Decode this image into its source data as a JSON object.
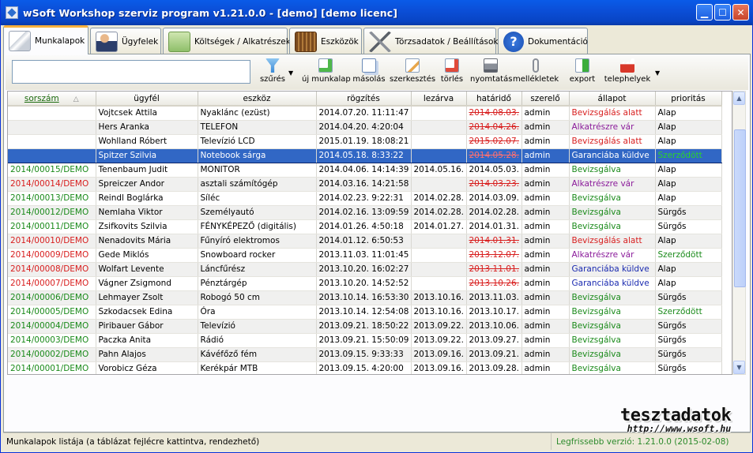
{
  "window": {
    "title": "wSoft Workshop szerviz program v1.21.0.0 - [demo] [demo licenc]"
  },
  "tabs": [
    {
      "label": "Munkalapok",
      "icon": "documents-icon",
      "active": true
    },
    {
      "label": "Ügyfelek",
      "icon": "person-card-icon"
    },
    {
      "label": "Költségek / Alkatrészek",
      "icon": "money-icon"
    },
    {
      "label": "Eszközök",
      "icon": "radio-device-icon"
    },
    {
      "label": "Törzsadatok / Beállítások",
      "icon": "tools-icon"
    },
    {
      "label": "Dokumentáció",
      "icon": "help-icon"
    }
  ],
  "toolbar": {
    "filter_value": "",
    "buttons": [
      {
        "label": "szűrés",
        "icon": "filter-funnel-icon"
      },
      {
        "label": "új munkalap",
        "icon": "new-document-icon"
      },
      {
        "label": "másolás",
        "icon": "copy-icon"
      },
      {
        "label": "szerkesztés",
        "icon": "edit-icon"
      },
      {
        "label": "törlés",
        "icon": "delete-icon"
      },
      {
        "label": "nyomtatás",
        "icon": "printer-icon"
      },
      {
        "label": "mellékletek",
        "icon": "paperclip-icon"
      },
      {
        "label": "export",
        "icon": "export-icon"
      },
      {
        "label": "telephelyek",
        "icon": "factory-icon"
      }
    ]
  },
  "table": {
    "columns": [
      "sorszám",
      "ügyfél",
      "eszköz",
      "rögzítés",
      "lezárva",
      "határidő",
      "szerelő",
      "állapot",
      "prioritás"
    ],
    "rows": [
      {
        "sorszam": "",
        "ugyfel": "Vojtcsek Attila",
        "eszkoz": "Nyaklánc (ezüst)",
        "rogzites": "2014.07.20. 11:11:47",
        "lezarva": "",
        "hatarido": "2014.08.03.",
        "szerelo": "admin",
        "allapot": "Bevizsgálás alatt",
        "prioritas": "Alap"
      },
      {
        "sorszam": "",
        "ugyfel": "Hers Aranka",
        "eszkoz": "TELEFON",
        "rogzites": "2014.04.20. 4:20:04",
        "lezarva": "",
        "hatarido": "2014.04.26.",
        "szerelo": "admin",
        "allapot": "Alkatrészre vár",
        "prioritas": "Alap"
      },
      {
        "sorszam": "",
        "ugyfel": "Wohlland Róbert",
        "eszkoz": "Televízió LCD",
        "rogzites": "2015.01.19. 18:08:21",
        "lezarva": "",
        "hatarido": "2015.02.07.",
        "szerelo": "admin",
        "allapot": "Bevizsgálás alatt",
        "prioritas": "Alap"
      },
      {
        "sorszam": "",
        "ugyfel": "Spitzer Szilvia",
        "eszkoz": "Notebook sárga",
        "rogzites": "2014.05.18. 8:33:22",
        "lezarva": "",
        "hatarido": "2014.05.28.",
        "szerelo": "admin",
        "allapot": "Garanciába küldve",
        "prioritas": "Szerződött"
      },
      {
        "sorszam": "2014/00015/DEMO",
        "ugyfel": "Tenenbaum Judit",
        "eszkoz": "MONITOR",
        "rogzites": "2014.04.06. 14:14:39",
        "lezarva": "2014.05.16.",
        "hatarido": "2014.05.03.",
        "szerelo": "admin",
        "allapot": "Bevizsgálva",
        "prioritas": "Alap"
      },
      {
        "sorszam": "2014/00014/DEMO",
        "ugyfel": "Spreiczer Andor",
        "eszkoz": "asztali számítógép",
        "rogzites": "2014.03.16. 14:21:58",
        "lezarva": "",
        "hatarido": "2014.03.23.",
        "szerelo": "admin",
        "allapot": "Alkatrészre vár",
        "prioritas": "Alap"
      },
      {
        "sorszam": "2014/00013/DEMO",
        "ugyfel": "Reindl Boglárka",
        "eszkoz": "Síléc",
        "rogzites": "2014.02.23. 9:22:31",
        "lezarva": "2014.02.28.",
        "hatarido": "2014.03.09.",
        "szerelo": "admin",
        "allapot": "Bevizsgálva",
        "prioritas": "Alap"
      },
      {
        "sorszam": "2014/00012/DEMO",
        "ugyfel": "Nemlaha Viktor",
        "eszkoz": "Személyautó",
        "rogzites": "2014.02.16. 13:09:59",
        "lezarva": "2014.02.28.",
        "hatarido": "2014.02.28.",
        "szerelo": "admin",
        "allapot": "Bevizsgálva",
        "prioritas": "Sürgős"
      },
      {
        "sorszam": "2014/00011/DEMO",
        "ugyfel": "Zsifkovits Szilvia",
        "eszkoz": "FÉNYKÉPEZŐ (digitális)",
        "rogzites": "2014.01.26. 4:50:18",
        "lezarva": "2014.01.27.",
        "hatarido": "2014.01.31.",
        "szerelo": "admin",
        "allapot": "Bevizsgálva",
        "prioritas": "Sürgős"
      },
      {
        "sorszam": "2014/00010/DEMO",
        "ugyfel": "Nenadovits Mária",
        "eszkoz": "Fűnyíró elektromos",
        "rogzites": "2014.01.12. 6:50:53",
        "lezarva": "",
        "hatarido": "2014.01.31.",
        "szerelo": "admin",
        "allapot": "Bevizsgálás alatt",
        "prioritas": "Alap"
      },
      {
        "sorszam": "2014/00009/DEMO",
        "ugyfel": "Gede Miklós",
        "eszkoz": "Snowboard rocker",
        "rogzites": "2013.11.03. 11:01:45",
        "lezarva": "",
        "hatarido": "2013.12.07.",
        "szerelo": "admin",
        "allapot": "Alkatrészre vár",
        "prioritas": "Szerződött"
      },
      {
        "sorszam": "2014/00008/DEMO",
        "ugyfel": "Wolfart Levente",
        "eszkoz": "Láncfűrész",
        "rogzites": "2013.10.20. 16:02:27",
        "lezarva": "",
        "hatarido": "2013.11.01.",
        "szerelo": "admin",
        "allapot": "Garanciába küldve",
        "prioritas": "Alap"
      },
      {
        "sorszam": "2014/00007/DEMO",
        "ugyfel": "Vágner Zsigmond",
        "eszkoz": "Pénztárgép",
        "rogzites": "2013.10.20. 14:52:52",
        "lezarva": "",
        "hatarido": "2013.10.26.",
        "szerelo": "admin",
        "allapot": "Garanciába küldve",
        "prioritas": "Alap"
      },
      {
        "sorszam": "2014/00006/DEMO",
        "ugyfel": "Lehmayer Zsolt",
        "eszkoz": "Robogó 50 cm",
        "rogzites": "2013.10.14. 16:53:30",
        "lezarva": "2013.10.16.",
        "hatarido": "2013.11.03.",
        "szerelo": "admin",
        "allapot": "Bevizsgálva",
        "prioritas": "Sürgős"
      },
      {
        "sorszam": "2014/00005/DEMO",
        "ugyfel": "Szkodacsek Edina",
        "eszkoz": "Óra",
        "rogzites": "2013.10.14. 12:54:08",
        "lezarva": "2013.10.16.",
        "hatarido": "2013.10.17.",
        "szerelo": "admin",
        "allapot": "Bevizsgálva",
        "prioritas": "Szerződött"
      },
      {
        "sorszam": "2014/00004/DEMO",
        "ugyfel": "Piribauer Gábor",
        "eszkoz": "Televízió",
        "rogzites": "2013.09.21. 18:50:22",
        "lezarva": "2013.09.22.",
        "hatarido": "2013.10.06.",
        "szerelo": "admin",
        "allapot": "Bevizsgálva",
        "prioritas": "Sürgős"
      },
      {
        "sorszam": "2014/00003/DEMO",
        "ugyfel": "Paczka Anita",
        "eszkoz": "Rádió",
        "rogzites": "2013.09.21. 15:50:09",
        "lezarva": "2013.09.22.",
        "hatarido": "2013.09.27.",
        "szerelo": "admin",
        "allapot": "Bevizsgálva",
        "prioritas": "Sürgős"
      },
      {
        "sorszam": "2014/00002/DEMO",
        "ugyfel": "Pahn Alajos",
        "eszkoz": "Kávéfőző fém",
        "rogzites": "2013.09.15. 9:33:33",
        "lezarva": "2013.09.16.",
        "hatarido": "2013.09.21.",
        "szerelo": "admin",
        "allapot": "Bevizsgálva",
        "prioritas": "Sürgős"
      },
      {
        "sorszam": "2014/00001/DEMO",
        "ugyfel": "Vorobicz Géza",
        "eszkoz": "Kerékpár MTB",
        "rogzites": "2013.09.15. 4:20:00",
        "lezarva": "2013.09.16.",
        "hatarido": "2013.09.28.",
        "szerelo": "admin",
        "allapot": "Bevizsgálva",
        "prioritas": "Sürgős"
      }
    ]
  },
  "statusbar": {
    "left": "Munkalapok listája (a táblázat fejlécre kattintva, rendezhető)",
    "right": "Legfrissebb verzió: 1.21.0.0 (2015-02-08)"
  },
  "watermark": {
    "line1": "tesztadatok",
    "line2": "http://www.wsoft.hu"
  },
  "colors": {
    "titlebar": "#0b4fd8",
    "selection": "#3167c5",
    "green": "#1a8a1a",
    "red": "#d81e1e",
    "purple": "#8a1a9a",
    "blue": "#1a2ab0"
  }
}
